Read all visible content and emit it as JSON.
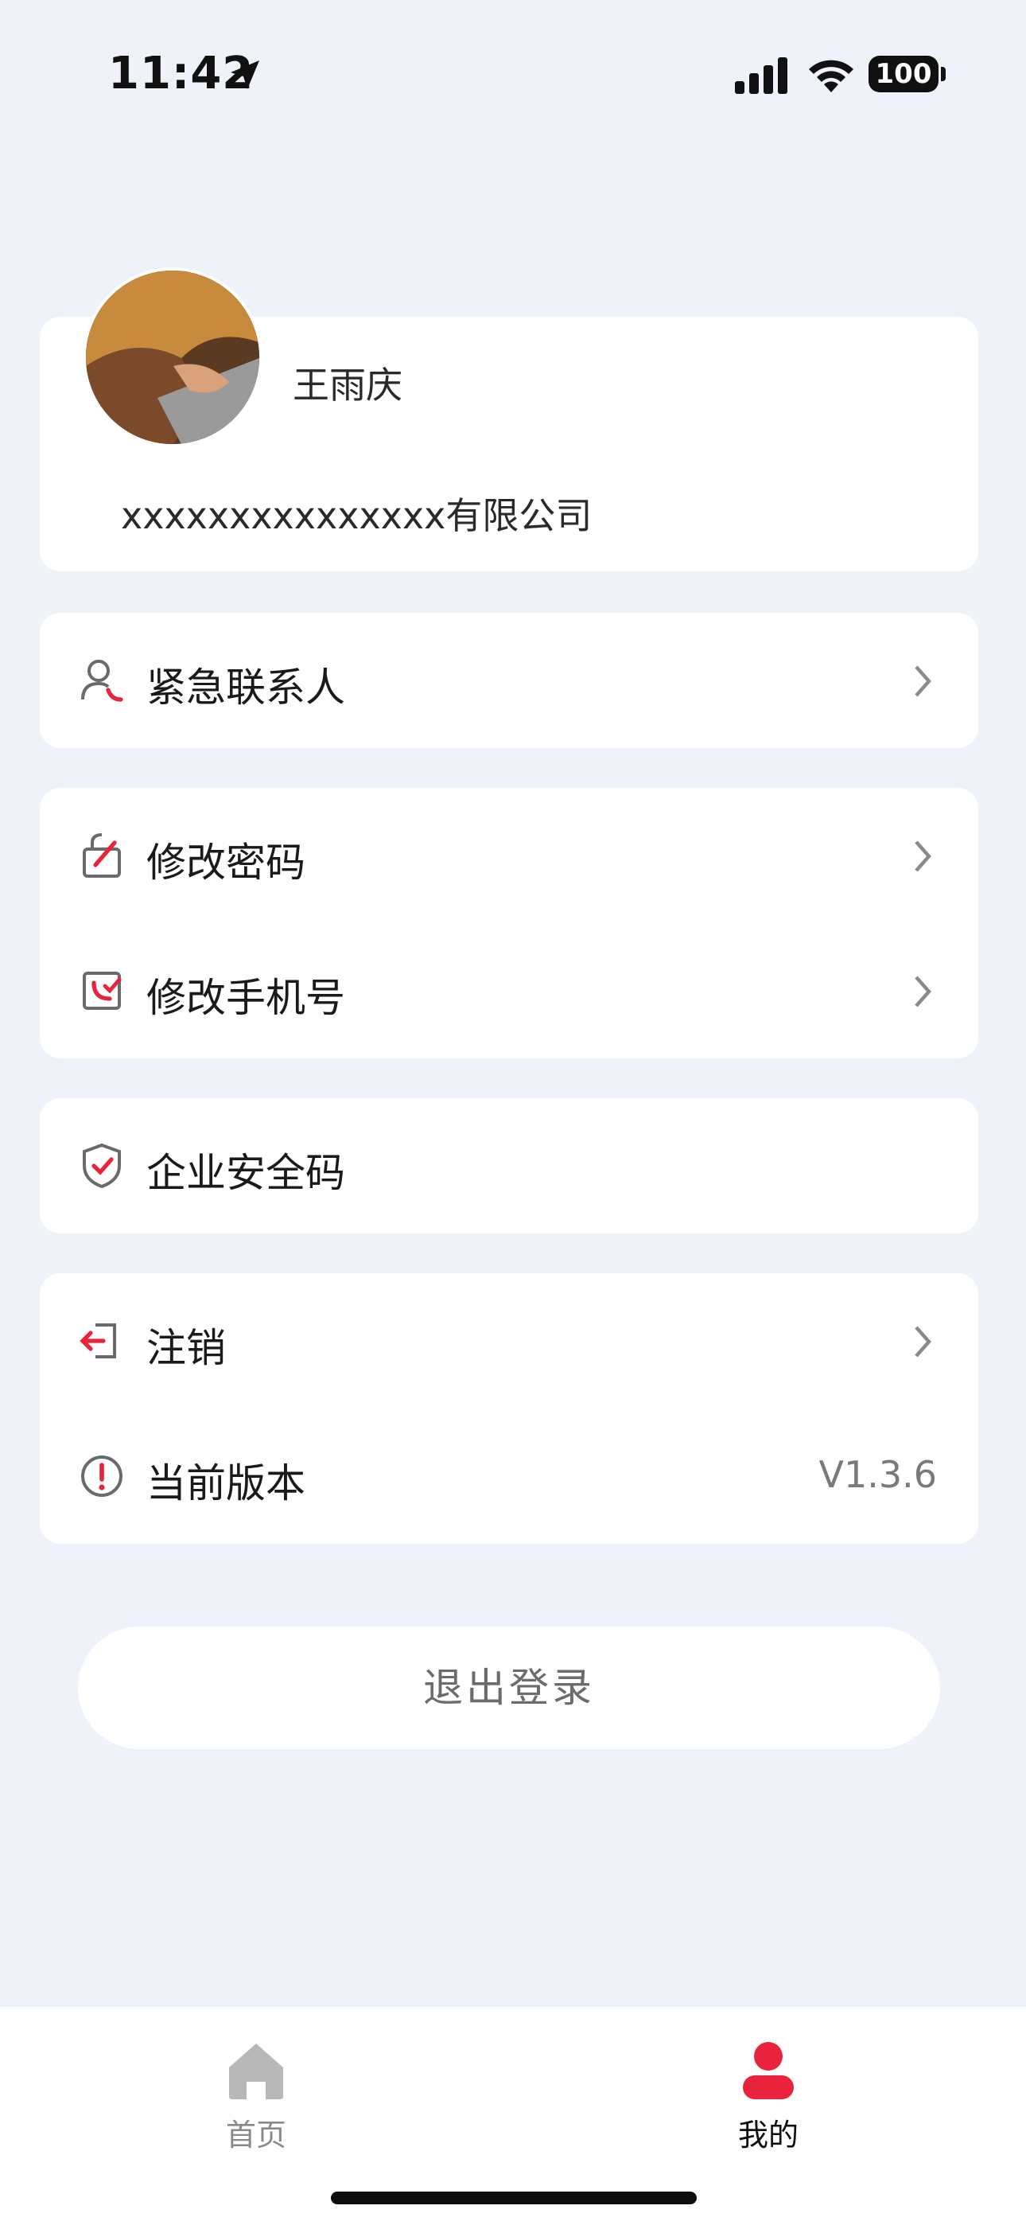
{
  "status_bar": {
    "time": "11:42",
    "battery": "100"
  },
  "profile": {
    "name": "王雨庆",
    "company": "xxxxxxxxxxxxxxx有限公司"
  },
  "menu": {
    "emergency_contact": "紧急联系人",
    "change_password": "修改密码",
    "change_phone": "修改手机号",
    "enterprise_security_code": "企业安全码",
    "deregister": "注销",
    "current_version": "当前版本",
    "version_value": "V1.3.6"
  },
  "logout_label": "退出登录",
  "tabs": [
    {
      "label": "首页",
      "icon": "home-icon",
      "active": false
    },
    {
      "label": "我的",
      "icon": "user-icon",
      "active": true
    }
  ],
  "colors": {
    "accent": "#E8233B",
    "background": "#EFF2F8",
    "icon_gray": "#6A6A6A"
  }
}
